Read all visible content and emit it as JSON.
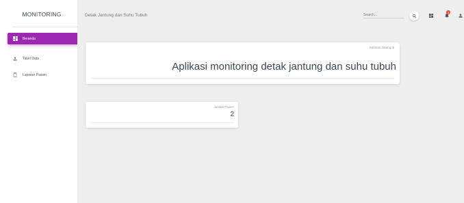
{
  "sidebar": {
    "brand": "MONITORING",
    "items": [
      {
        "label": "Beranda",
        "icon": "dashboard-icon",
        "active": true
      },
      {
        "label": "Tabel Data",
        "icon": "person-icon",
        "active": false
      },
      {
        "label": "Laporan Pasien",
        "icon": "clipboard-icon",
        "active": false
      }
    ]
  },
  "header": {
    "title": "Detak Jantung dan Suhu Tubuh",
    "search_placeholder": "Search...",
    "notifications_count": "5",
    "icons": [
      "search-icon",
      "dashboard-icon",
      "notifications-icon",
      "person-icon"
    ]
  },
  "welcome_card": {
    "label": "Selamat datang di",
    "title": "Aplikasi monitoring detak jantung dan suhu tubuh"
  },
  "patients_card": {
    "label": "Jumlah Pasien",
    "value": "2"
  },
  "colors": {
    "accent": "#9c27b0",
    "background": "#eeeeee",
    "card": "#ffffff",
    "badge": "#f44336"
  }
}
